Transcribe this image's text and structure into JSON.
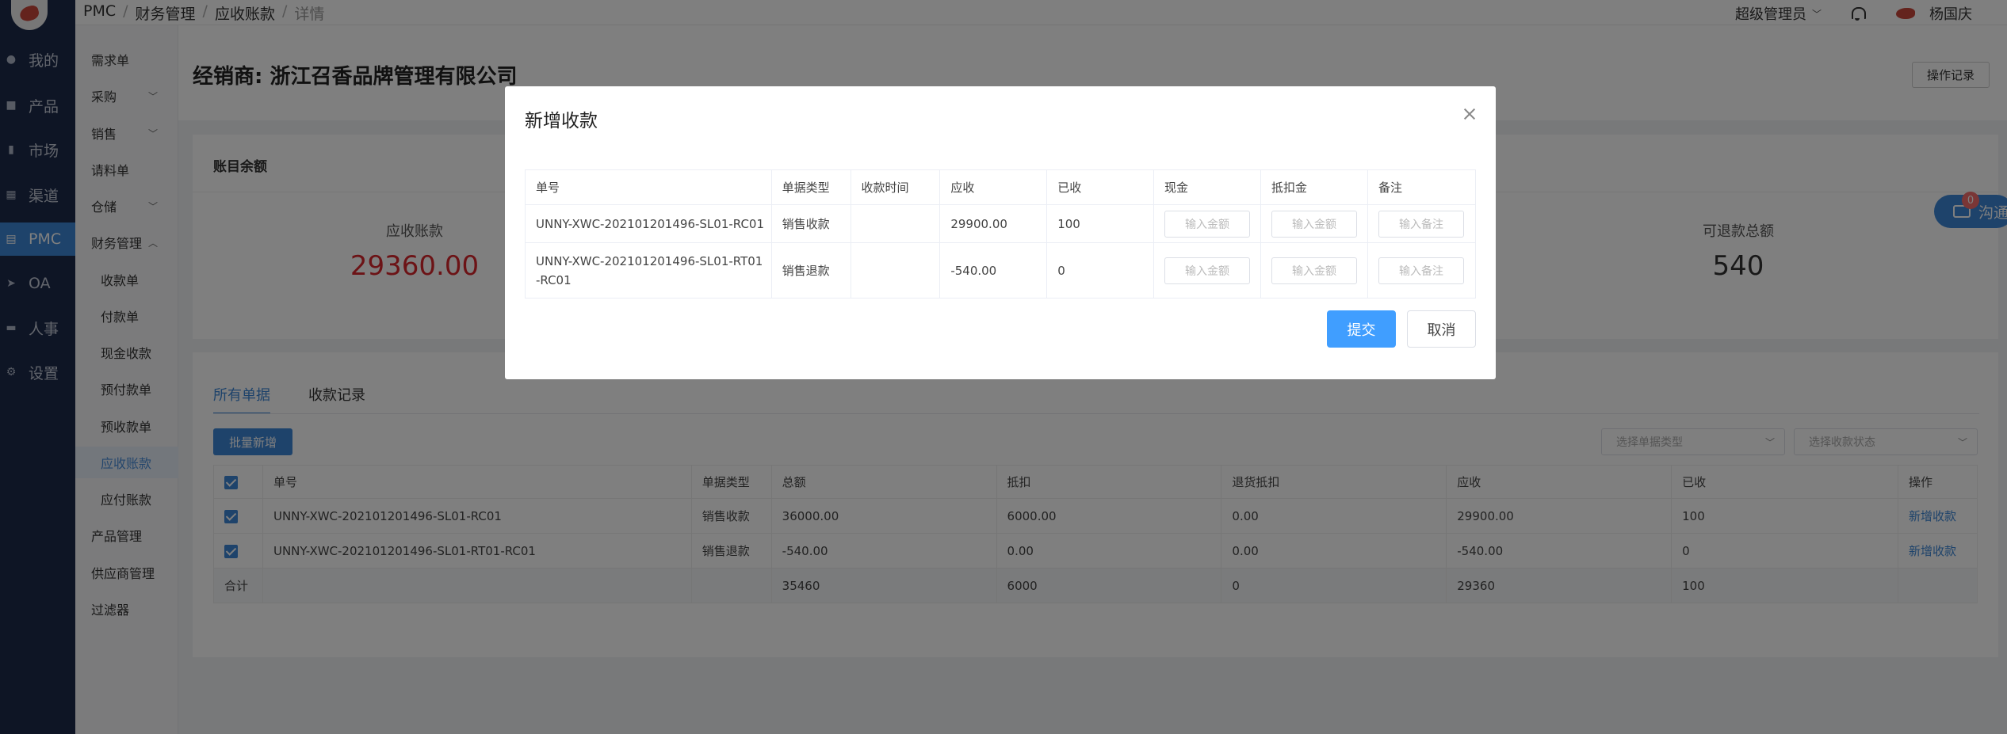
{
  "breadcrumb": [
    "PMC",
    "财务管理",
    "应收账款",
    "详情"
  ],
  "header": {
    "role": "超级管理员",
    "user": "杨国庆"
  },
  "rail": [
    {
      "label": "我的",
      "icon": "user-icon"
    },
    {
      "label": "产品",
      "icon": "box-icon"
    },
    {
      "label": "市场",
      "icon": "bar-chart-icon"
    },
    {
      "label": "渠道",
      "icon": "grid-icon"
    },
    {
      "label": "PMC",
      "icon": "document-icon"
    },
    {
      "label": "OA",
      "icon": "send-icon"
    },
    {
      "label": "人事",
      "icon": "chat-icon"
    },
    {
      "label": "设置",
      "icon": "gear-icon"
    }
  ],
  "submenu": [
    "需求单",
    "采购",
    "销售",
    "请料单",
    "仓储",
    "财务管理",
    "收款单",
    "付款单",
    "现金收款",
    "预付款单",
    "预收款单",
    "应收账款",
    "应付账款",
    "产品管理",
    "供应商管理",
    "过滤器"
  ],
  "page": {
    "company": "经销商: 浙江召香品牌管理有限公司",
    "oplog": "操作记录",
    "balance_title": "账目余额",
    "receivable_label": "应收账款",
    "receivable_value": "29360.00",
    "refundable_label": "可退款总额",
    "refundable_value": "540",
    "chat_label": "沟通",
    "chat_badge": "0"
  },
  "list": {
    "tabs": [
      "所有单据",
      "收款记录"
    ],
    "batch_add": "批量新增",
    "filter_type": "选择单据类型",
    "filter_status": "选择收款状态",
    "columns": [
      "单号",
      "单据类型",
      "总额",
      "抵扣",
      "退货抵扣",
      "应收",
      "已收",
      "操作"
    ],
    "rows": [
      [
        "UNNY-XWC-202101201496-SL01-RC01",
        "销售收款",
        "36000.00",
        "6000.00",
        "0.00",
        "29900.00",
        "100",
        "新增收款"
      ],
      [
        "UNNY-XWC-202101201496-SL01-RT01-RC01",
        "销售退款",
        "-540.00",
        "0.00",
        "0.00",
        "-540.00",
        "0",
        "新增收款"
      ]
    ],
    "total": [
      "合计",
      "",
      "35460",
      "6000",
      "0",
      "29360",
      "100",
      ""
    ]
  },
  "modal": {
    "title": "新增收款",
    "columns": [
      "单号",
      "单据类型",
      "收款时间",
      "应收",
      "已收",
      "现金",
      "抵扣金",
      "备注"
    ],
    "rows": [
      [
        "UNNY-XWC-202101201496-SL01-RC01",
        "销售收款",
        "",
        "29900.00",
        "100"
      ],
      [
        "UNNY-XWC-202101201496-SL01-RT01-RC01",
        "销售退款",
        "",
        "-540.00",
        "0"
      ]
    ],
    "cash_placeholder": "输入金额",
    "deduct_placeholder": "输入金额",
    "note_placeholder": "输入备注",
    "submit": "提交",
    "cancel": "取消"
  },
  "colors": {
    "accent": "#3c86d6",
    "primary_button": "#409eff",
    "rail_bg": "#1d2b4a",
    "receivable": "#d9262c",
    "overlay": "rgba(0,0,0,0.5)"
  }
}
